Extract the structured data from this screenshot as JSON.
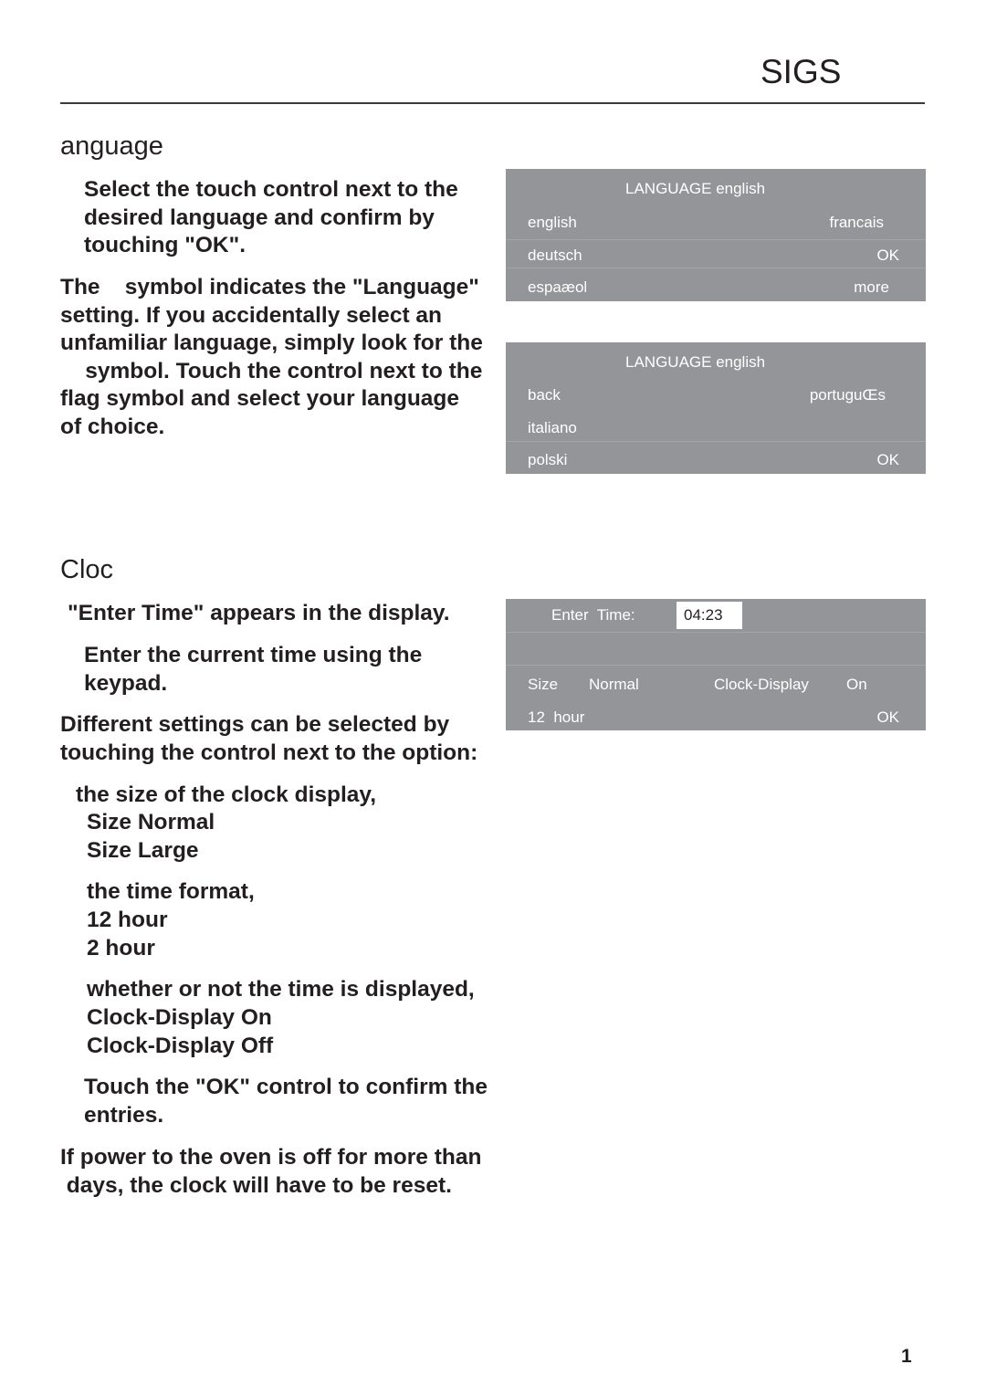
{
  "header": {
    "title": "SIGS"
  },
  "language_section": {
    "heading": "anguage",
    "step1": "Select the touch control next to the\ndesired language and confirm by\ntouching \"OK\".",
    "note": "The    symbol indicates the \"Language\"\nsetting. If you accidentally select an\nunfamiliar language, simply look for the\n    symbol. Touch the control next to the\nflag symbol and select your language\nof choice."
  },
  "language_panel_1": {
    "title": "LANGUAGE  english",
    "rows": [
      {
        "left": "english",
        "right": "francais"
      },
      {
        "left": "deutsch",
        "right": "OK"
      },
      {
        "left": "espaæol",
        "right": "more"
      }
    ]
  },
  "language_panel_2": {
    "title": "LANGUAGE  english",
    "rows": [
      {
        "left": "back",
        "right": "portuguŒs"
      },
      {
        "left": "italiano",
        "right": ""
      },
      {
        "left": "polski",
        "right": "OK"
      }
    ]
  },
  "clock_section": {
    "heading": "Cloc",
    "line1": "\"Enter Time\" appears in the display.",
    "step1": "Enter the current time using the\nkeypad.",
    "intro": "Different settings can be selected by\ntouching the control next to the option:",
    "option_size": "the size of the clock display,",
    "size_values": "Size Normal\nSize Large",
    "option_format": "the time format,",
    "format_values": "12 hour\n2 hour",
    "option_display": "whether or not the time is displayed,",
    "display_values": "Clock-Display On\nClock-Display Off",
    "step_ok": "Touch the \"OK\" control to confirm the\nentries.",
    "power_note": "If power to the oven is off for more than\n days, the clock will have to be reset."
  },
  "clock_panel": {
    "enter_time_label": "Enter  Time:",
    "time_value": "04:23",
    "size_label": "Size",
    "size_value": "Normal",
    "clock_display_label": "Clock-Display",
    "clock_display_value": "On",
    "format_value": "12  hour",
    "ok_label": "OK"
  },
  "footer": {
    "page_number": "1"
  }
}
